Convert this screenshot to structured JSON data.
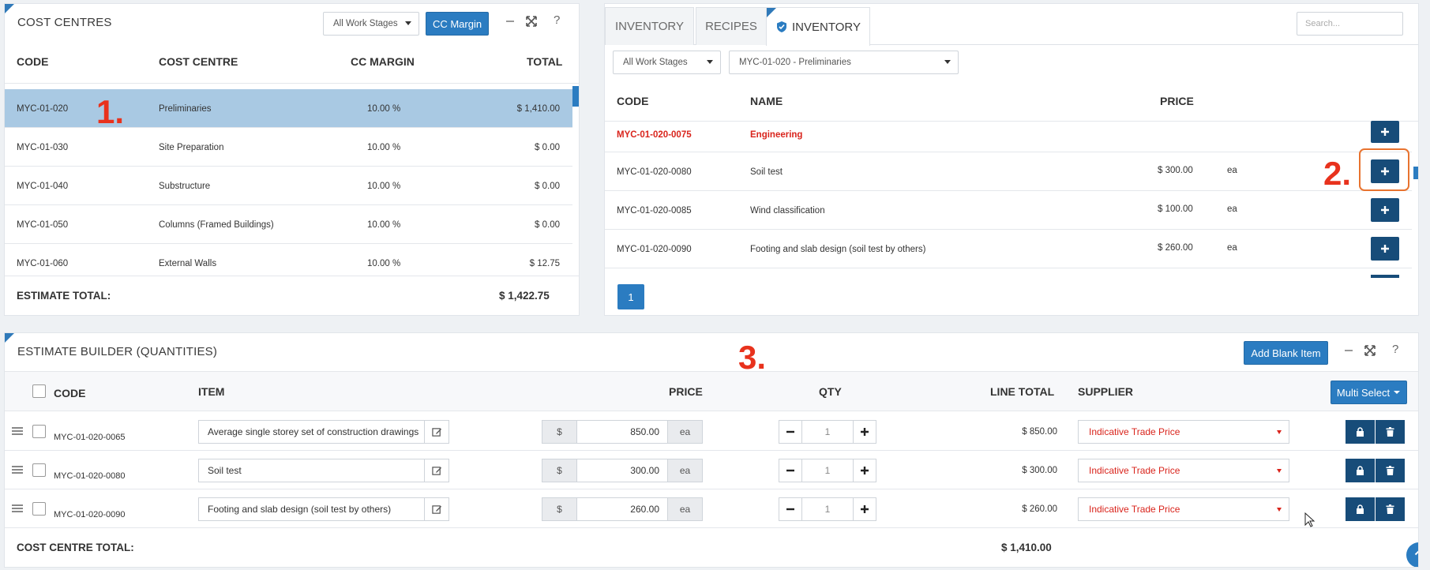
{
  "cost_centres": {
    "title": "COST CENTRES",
    "work_stage_select": "All Work Stages",
    "cc_margin_button": "CC Margin",
    "columns": [
      "CODE",
      "COST CENTRE",
      "CC MARGIN",
      "TOTAL"
    ],
    "rows": [
      {
        "code": "MYC-01-020",
        "name": "Preliminaries",
        "margin": "10.00 %",
        "total": "$ 1,410.00",
        "selected": true
      },
      {
        "code": "MYC-01-030",
        "name": "Site Preparation",
        "margin": "10.00 %",
        "total": "$ 0.00"
      },
      {
        "code": "MYC-01-040",
        "name": "Substructure",
        "margin": "10.00 %",
        "total": "$ 0.00"
      },
      {
        "code": "MYC-01-050",
        "name": "Columns (Framed Buildings)",
        "margin": "10.00 %",
        "total": "$ 0.00"
      },
      {
        "code": "MYC-01-060",
        "name": "External Walls",
        "margin": "10.00 %",
        "total": "$ 12.75"
      }
    ],
    "estimate_total_label": "ESTIMATE TOTAL:",
    "estimate_total_value": "$ 1,422.75"
  },
  "inventory": {
    "tabs": [
      "INVENTORY",
      "RECIPES",
      "INVENTORY"
    ],
    "search_placeholder": "Search...",
    "work_stage_select": "All Work Stages",
    "cost_centre_select": "MYC-01-020 - Preliminaries",
    "columns": [
      "CODE",
      "NAME",
      "PRICE"
    ],
    "rows": [
      {
        "code": "MYC-01-020-0075",
        "name": "Engineering",
        "price": "",
        "unit": "",
        "heading": true
      },
      {
        "code": "MYC-01-020-0080",
        "name": "Soil test",
        "price": "$ 300.00",
        "unit": "ea"
      },
      {
        "code": "MYC-01-020-0085",
        "name": "Wind classification",
        "price": "$ 100.00",
        "unit": "ea"
      },
      {
        "code": "MYC-01-020-0090",
        "name": "Footing and slab design (soil test by others)",
        "price": "$ 260.00",
        "unit": "ea"
      }
    ],
    "page": "1"
  },
  "estimate_builder": {
    "title": "ESTIMATE BUILDER (QUANTITIES)",
    "add_blank_button": "Add Blank Item",
    "multi_select_button": "Multi Select",
    "columns": {
      "code": "CODE",
      "item": "ITEM",
      "price": "PRICE",
      "qty": "QTY",
      "line_total": "LINE TOTAL",
      "supplier": "SUPPLIER"
    },
    "currency_symbol": "$",
    "rows": [
      {
        "code": "MYC-01-020-0065",
        "item": "Average single storey set of construction drawings",
        "price": "850.00",
        "unit": "ea",
        "qty": "1",
        "line_total": "$ 850.00",
        "supplier": "Indicative Trade Price"
      },
      {
        "code": "MYC-01-020-0080",
        "item": "Soil test",
        "price": "300.00",
        "unit": "ea",
        "qty": "1",
        "line_total": "$ 300.00",
        "supplier": "Indicative Trade Price"
      },
      {
        "code": "MYC-01-020-0090",
        "item": "Footing and slab design (soil test by others)",
        "price": "260.00",
        "unit": "ea",
        "qty": "1",
        "line_total": "$ 260.00",
        "supplier": "Indicative Trade Price"
      }
    ],
    "cost_centre_total_label": "COST CENTRE TOTAL:",
    "cost_centre_total_value": "$ 1,410.00"
  },
  "annotations": [
    "1.",
    "2.",
    "3."
  ],
  "icons": {
    "minimize": "minimize-icon",
    "expand": "expand-icon",
    "help": "help-icon",
    "plus": "plus-icon",
    "edit": "edit-icon",
    "lock": "lock-icon",
    "trash": "trash-icon",
    "arrow_up": "arrow-up-icon",
    "drag": "drag-handle-icon"
  },
  "colors": {
    "primary": "#2b7cc1",
    "dark_button": "#174c79",
    "selected_row": "#a9c9e3",
    "annotation": "#e8321d",
    "heading_red": "#d9241c"
  }
}
